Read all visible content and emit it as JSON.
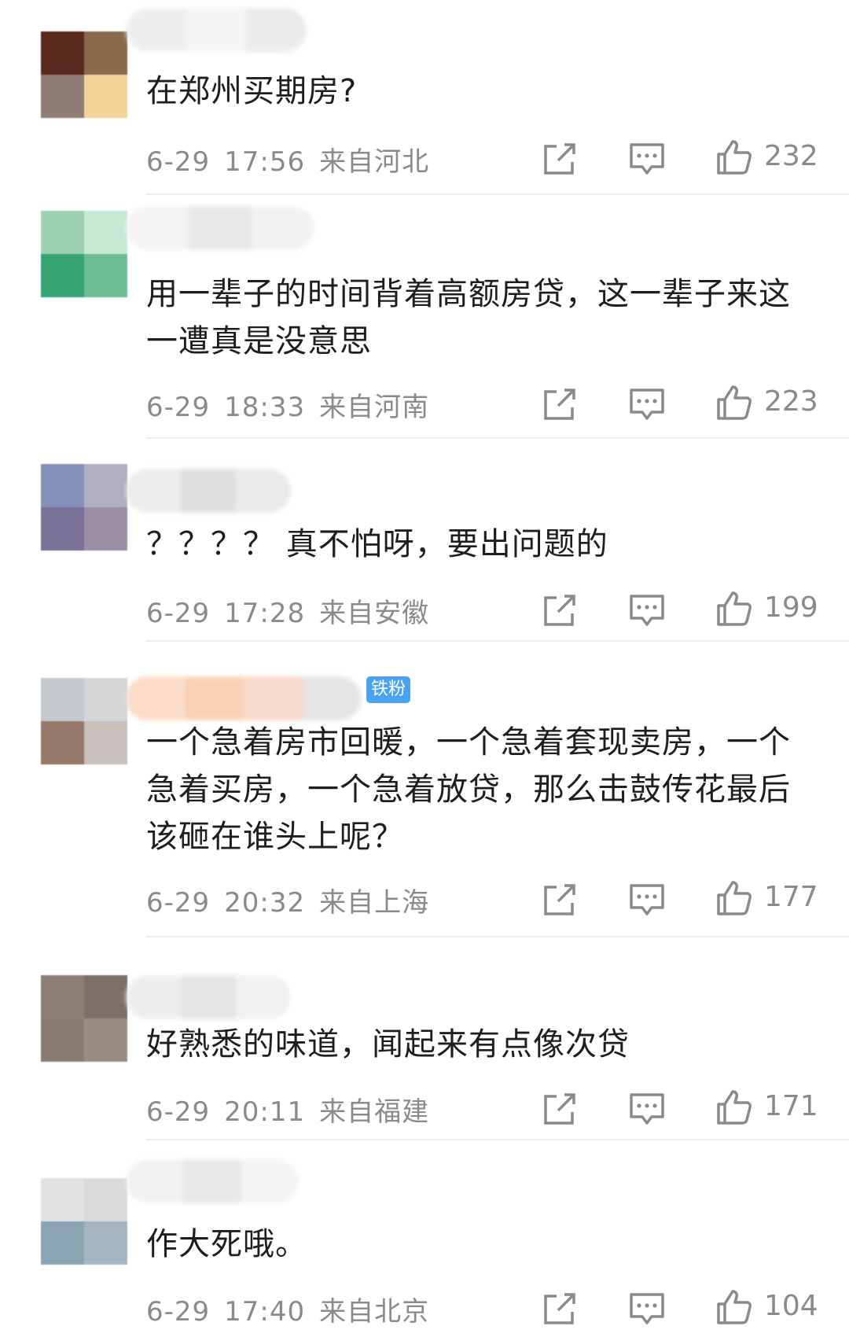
{
  "comments": [
    {
      "text": "在郑州买期房?",
      "date": "6-29",
      "time": "17:56",
      "location": "来自河北",
      "likes": "232"
    },
    {
      "text": "用一辈子的时间背着高额房贷，这一辈子来这一遭真是没意思",
      "date": "6-29",
      "time": "18:33",
      "location": "来自河南",
      "likes": "223"
    },
    {
      "text": "？？？？ 真不怕呀，要出问题的",
      "date": "6-29",
      "time": "17:28",
      "location": "来自安徽",
      "likes": "199"
    },
    {
      "badge": "铁粉",
      "text": "一个急着房市回暖，一个急着套现卖房，一个急着买房，一个急着放贷，那么击鼓传花最后该砸在谁头上呢？",
      "date": "6-29",
      "time": "20:32",
      "location": "来自上海",
      "likes": "177"
    },
    {
      "text": "好熟悉的味道，闻起来有点像次贷",
      "date": "6-29",
      "time": "20:11",
      "location": "来自福建",
      "likes": "171"
    },
    {
      "text": "作大死哦。",
      "date": "6-29",
      "time": "17:40",
      "location": "来自北京",
      "likes": "104"
    }
  ],
  "icons": {
    "share": "share-icon",
    "reply": "comment-icon",
    "like": "thumbs-up-icon"
  }
}
